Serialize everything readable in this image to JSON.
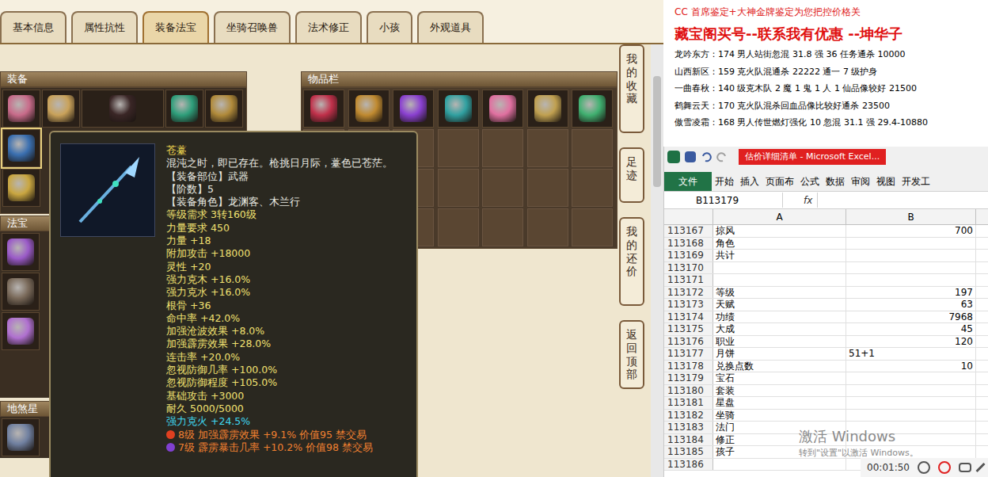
{
  "tabs": [
    {
      "label": "基本信息",
      "selected": false
    },
    {
      "label": "属性抗性",
      "selected": false
    },
    {
      "label": "装备法宝",
      "selected": true
    },
    {
      "label": "坐骑召唤兽",
      "selected": false
    },
    {
      "label": "法术修正",
      "selected": false
    },
    {
      "label": "小孩",
      "selected": false
    },
    {
      "label": "外观道具",
      "selected": false
    }
  ],
  "side_buttons": [
    "我的收藏",
    "足迹",
    "我的还价",
    "返回顶部"
  ],
  "equipment": {
    "title": "装备",
    "top_slots": [
      {
        "color": "#c86b8a"
      },
      {
        "color": "#c9a25a"
      },
      {
        "color": "#3a2626"
      },
      {
        "color": "#2e9e7a"
      },
      {
        "color": "#b08a3a"
      }
    ],
    "side_slots": [
      {
        "color": "#3a6fb0",
        "selected": true
      },
      {
        "color": "#c9a640",
        "selected": false
      }
    ]
  },
  "fabao": {
    "title": "法宝",
    "slots": [
      {
        "color": "#9a5ac8"
      },
      {
        "color": "#7a6a5a"
      },
      {
        "color": "#b070d0"
      }
    ]
  },
  "dishaxing": {
    "title": "地煞星"
  },
  "inventory": {
    "title": "物品栏",
    "items": [
      {
        "color": "#c0304a"
      },
      {
        "color": "#c08a30"
      },
      {
        "color": "#8a40d0"
      },
      {
        "color": "#30a0a0"
      },
      {
        "color": "#e070a0"
      },
      {
        "color": "#c0a050"
      },
      {
        "color": "#40b070"
      }
    ]
  },
  "tooltip": {
    "lines": [
      {
        "kind": "name",
        "text": "苍薹"
      },
      {
        "kind": "text",
        "text": "混沌之时，即已存在。枪挑日月际，薹色已苍茫。"
      },
      {
        "kind": "text",
        "text": "【装备部位】武器"
      },
      {
        "kind": "text",
        "text": "【阶数】5"
      },
      {
        "kind": "text",
        "text": "【装备角色】龙渊客、木兰行"
      },
      {
        "kind": "highlight",
        "text": "等级需求 3转160级"
      },
      {
        "kind": "highlight",
        "text": "力量要求 450"
      },
      {
        "kind": "highlight",
        "text": "力量 +18"
      },
      {
        "kind": "highlight",
        "text": "附加攻击 +18000"
      },
      {
        "kind": "highlight",
        "text": "灵性 +20"
      },
      {
        "kind": "highlight",
        "text": "强力克木 +16.0%"
      },
      {
        "kind": "highlight",
        "text": "强力克水 +16.0%"
      },
      {
        "kind": "highlight",
        "text": "根骨 +36"
      },
      {
        "kind": "highlight",
        "text": "命中率 +42.0%"
      },
      {
        "kind": "highlight",
        "text": "加强沧波效果 +8.0%"
      },
      {
        "kind": "highlight",
        "text": "加强霹雳效果 +28.0%"
      },
      {
        "kind": "highlight",
        "text": "连击率 +20.0%"
      },
      {
        "kind": "highlight",
        "text": "忽视防御几率 +100.0%"
      },
      {
        "kind": "highlight",
        "text": "忽视防御程度 +105.0%"
      },
      {
        "kind": "highlight",
        "text": "基础攻击 +3000"
      },
      {
        "kind": "highlight",
        "text": "耐久 5000/5000"
      },
      {
        "kind": "special",
        "text": "强力克火 +24.5%"
      },
      {
        "kind": "gem",
        "text": "8级 加强霹雳效果 +9.1% 价值95 禁交易",
        "color": "#e04020"
      },
      {
        "kind": "gem",
        "text": "7级 霹雳暴击几率 +10.2% 价值98 禁交易",
        "color": "#8040d0"
      }
    ]
  },
  "ads": {
    "header": "CC 首席鉴定+大神金牌鉴定为您把控价格关",
    "headline": "藏宝阁买号--联系我有优惠 --坤华子",
    "listings": [
      "龙吟东方：174 男人站街忽混 31.8 强 36 任务通杀 10000",
      "山西新区：159 克火队混通杀 22222 通一 7 级护身",
      "一曲春秋：140 级克木队 2 魔 1 鬼 1 人 1 仙品像较好 21500",
      "鹤舞云天：170 克火队混杀回血品像比较好通杀 23500",
      "傲雪凌霜：168 男人传世燃灯强化 10 忽混 31.1 强 29.4-10880"
    ]
  },
  "excel": {
    "title": "估价详细清单 - Microsoft Excel...",
    "ribbon_tabs": [
      {
        "label": "文件",
        "selected": true
      },
      {
        "label": "开始",
        "selected": false
      },
      {
        "label": "插入",
        "selected": false
      },
      {
        "label": "页面布",
        "selected": false
      },
      {
        "label": "公式",
        "selected": false
      },
      {
        "label": "数据",
        "selected": false
      },
      {
        "label": "审阅",
        "selected": false
      },
      {
        "label": "视图",
        "selected": false
      },
      {
        "label": "开发工",
        "selected": false
      }
    ],
    "name_box": "B113179",
    "fx": "fx",
    "columns": [
      "A",
      "B"
    ],
    "rows": [
      {
        "num": "113167",
        "a": "掠风",
        "b": "700",
        "b_align": "right"
      },
      {
        "num": "113168",
        "a": "角色",
        "b": "",
        "b_align": "right"
      },
      {
        "num": "113169",
        "a": "共计",
        "b": "",
        "b_align": "right"
      },
      {
        "num": "113170",
        "a": "",
        "b": "",
        "b_align": "right"
      },
      {
        "num": "113171",
        "a": "",
        "b": "",
        "b_align": "right"
      },
      {
        "num": "113172",
        "a": "等级",
        "b": "197",
        "b_align": "right"
      },
      {
        "num": "113173",
        "a": "天赋",
        "b": "63",
        "b_align": "right"
      },
      {
        "num": "113174",
        "a": "功绩",
        "b": "7968",
        "b_align": "right"
      },
      {
        "num": "113175",
        "a": "大成",
        "b": "45",
        "b_align": "right"
      },
      {
        "num": "113176",
        "a": "职业",
        "b": "120",
        "b_align": "right"
      },
      {
        "num": "113177",
        "a": "月饼",
        "b": "51+1",
        "b_align": "left"
      },
      {
        "num": "113178",
        "a": "兑换点数",
        "b": "10",
        "b_align": "right"
      },
      {
        "num": "113179",
        "a": "宝石",
        "b": "",
        "b_align": "right"
      },
      {
        "num": "113180",
        "a": "套装",
        "b": "",
        "b_align": "right"
      },
      {
        "num": "113181",
        "a": "星盘",
        "b": "",
        "b_align": "right"
      },
      {
        "num": "113182",
        "a": "坐骑",
        "b": "",
        "b_align": "right"
      },
      {
        "num": "113183",
        "a": "法门",
        "b": "",
        "b_align": "right"
      },
      {
        "num": "113184",
        "a": "修正",
        "b": "",
        "b_align": "right"
      },
      {
        "num": "113185",
        "a": "孩子",
        "b": "",
        "b_align": "right"
      },
      {
        "num": "113186",
        "a": "",
        "b": "",
        "b_align": "right"
      }
    ]
  },
  "watermark": {
    "title": "激活 Windows",
    "subtitle": "转到\"设置\"以激活 Windows。"
  },
  "recorder": {
    "time": "00:01:50"
  }
}
